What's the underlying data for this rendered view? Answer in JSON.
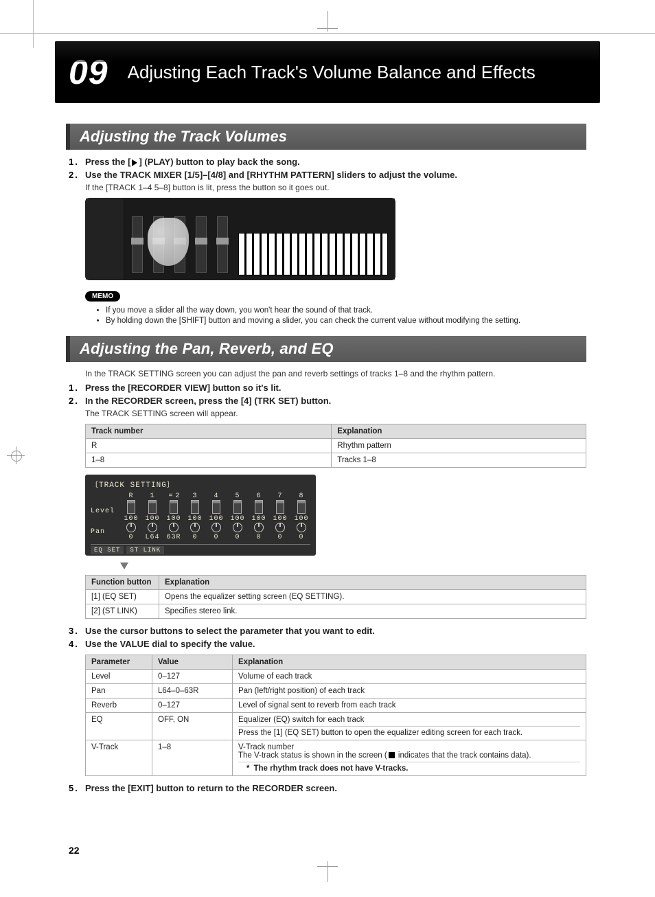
{
  "chapter": {
    "number": "09",
    "title": "Adjusting Each Track's Volume Balance and Effects"
  },
  "section1": {
    "heading": "Adjusting the Track Volumes",
    "step1_pre": "Press the [",
    "step1_mid": "] (PLAY) button to play back the song.",
    "step2": "Use the TRACK MIXER [1/5]–[4/8] and [RHYTHM PATTERN] sliders to adjust the volume.",
    "step2_note": "If the [TRACK 1–4 5–8] button is lit, press the button so it goes out.",
    "memo_tag": "MEMO",
    "memo1": "If you move a slider all the way down, you won't hear the sound of that track.",
    "memo2": "By holding down the [SHIFT] button and moving a slider, you can check the current value without modifying the setting."
  },
  "section2": {
    "heading": "Adjusting the Pan, Reverb, and EQ",
    "intro": "In the TRACK SETTING screen you can adjust the pan and reverb settings of tracks 1–8 and the rhythm pattern.",
    "step1": "Press the [RECORDER VIEW] button so it's lit.",
    "step2": "In the RECORDER screen, press the [4] (TRK SET) button.",
    "step2_note": "The TRACK SETTING screen will appear.",
    "step3": "Use the cursor buttons to select the parameter that you want to edit.",
    "step4": "Use the VALUE dial to specify the value.",
    "step5": "Press the [EXIT] button to return to the RECORDER screen."
  },
  "table_tracknum": {
    "h1": "Track number",
    "h2": "Explanation",
    "r1c1": "R",
    "r1c2": "Rhythm pattern",
    "r2c1": "1–8",
    "r2c2": "Tracks 1–8"
  },
  "lcd": {
    "title": "TRACK SETTING",
    "cols": [
      "R",
      "1",
      "2",
      "3",
      "4",
      "5",
      "6",
      "7",
      "8"
    ],
    "row_level": "Level",
    "row_pan": "Pan",
    "levels": [
      "100",
      "100",
      "100",
      "100",
      "100",
      "100",
      "100",
      "100",
      "100"
    ],
    "pans": [
      "0",
      "L64",
      "63R",
      "0",
      "0",
      "0",
      "0",
      "0",
      "0"
    ],
    "tab1": "EQ SET",
    "tab2": "ST LINK"
  },
  "table_func": {
    "h1": "Function button",
    "h2": "Explanation",
    "r1c1": "[1] (EQ SET)",
    "r1c2": "Opens the equalizer setting screen (EQ SETTING).",
    "r2c1": "[2] (ST LINK)",
    "r2c2": "Specifies stereo link."
  },
  "table_param": {
    "h1": "Parameter",
    "h2": "Value",
    "h3": "Explanation",
    "r": [
      {
        "p": "Level",
        "v": "0–127",
        "e": "Volume of each track"
      },
      {
        "p": "Pan",
        "v": "L64–0–63R",
        "e": "Pan (left/right position) of each track"
      },
      {
        "p": "Reverb",
        "v": "0–127",
        "e": "Level of signal sent to reverb from each track"
      },
      {
        "p": "EQ",
        "v": "OFF, ON",
        "e1": "Equalizer (EQ) switch for each track",
        "e2": "Press the [1] (EQ SET) button to open the equalizer editing screen for each track."
      },
      {
        "p": "V-Track",
        "v": "1–8",
        "e1": "V-Track number",
        "e2_pre": "The V-track status is shown in the screen (",
        "e2_post": " indicates that the track contains data).",
        "e3": "The rhythm track does not have V-tracks."
      }
    ]
  },
  "pagenum": "22"
}
